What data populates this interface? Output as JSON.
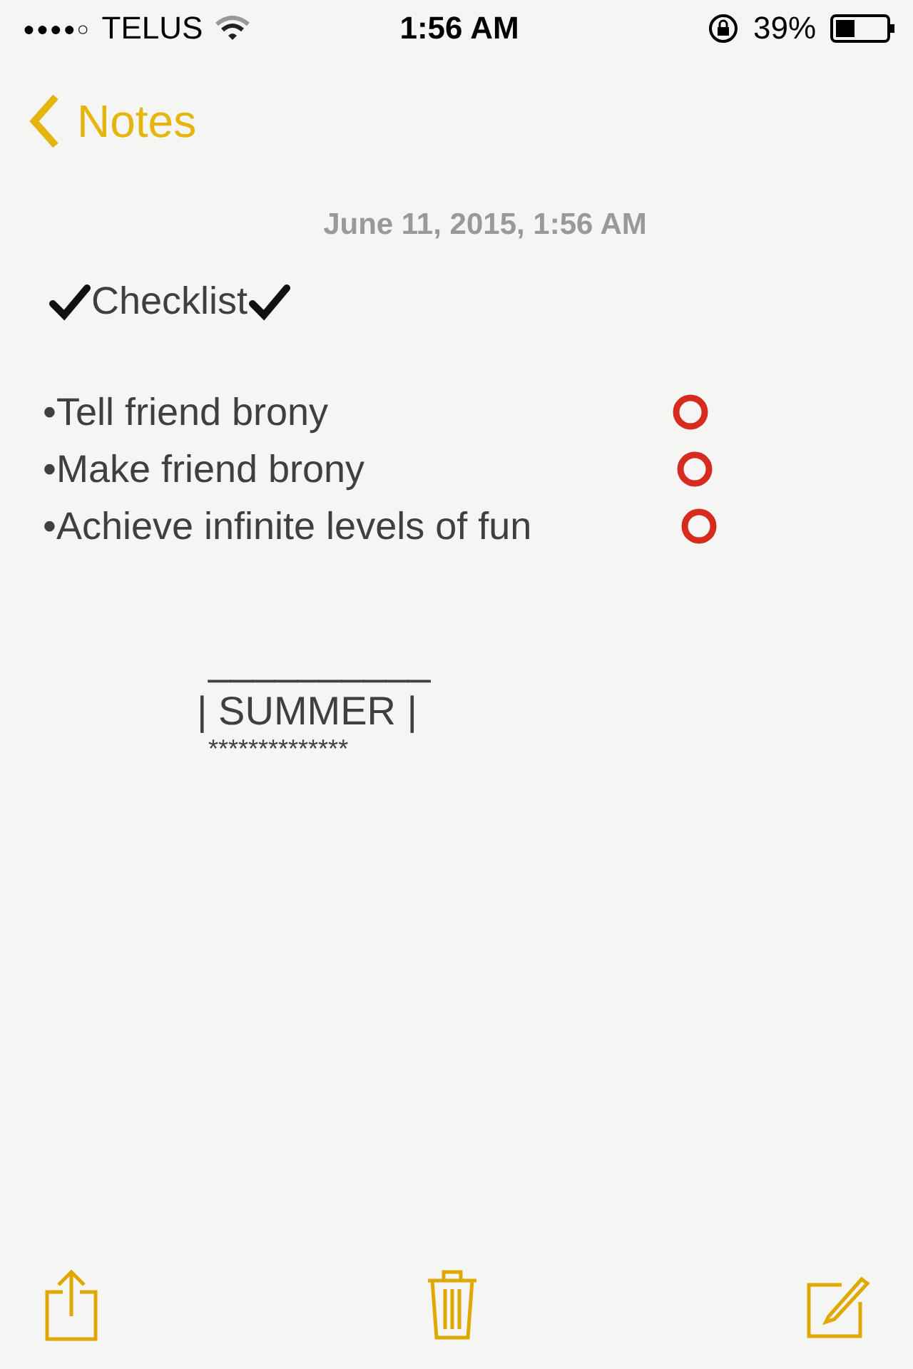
{
  "status_bar": {
    "carrier": "TELUS",
    "signal_dots": "●●●●○",
    "time": "1:56 AM",
    "battery": "39%"
  },
  "nav": {
    "back": "Notes"
  },
  "note": {
    "date": "June 11, 2015, 1:56 AM",
    "title": "Checklist",
    "items": [
      {
        "text": "•Tell friend brony"
      },
      {
        "text": "•Make friend brony"
      },
      {
        "text": "•Achieve infinite levels of fun"
      }
    ],
    "banner": {
      "top": "__________",
      "middle": "| SUMMER |",
      "bottom": "**************"
    }
  }
}
